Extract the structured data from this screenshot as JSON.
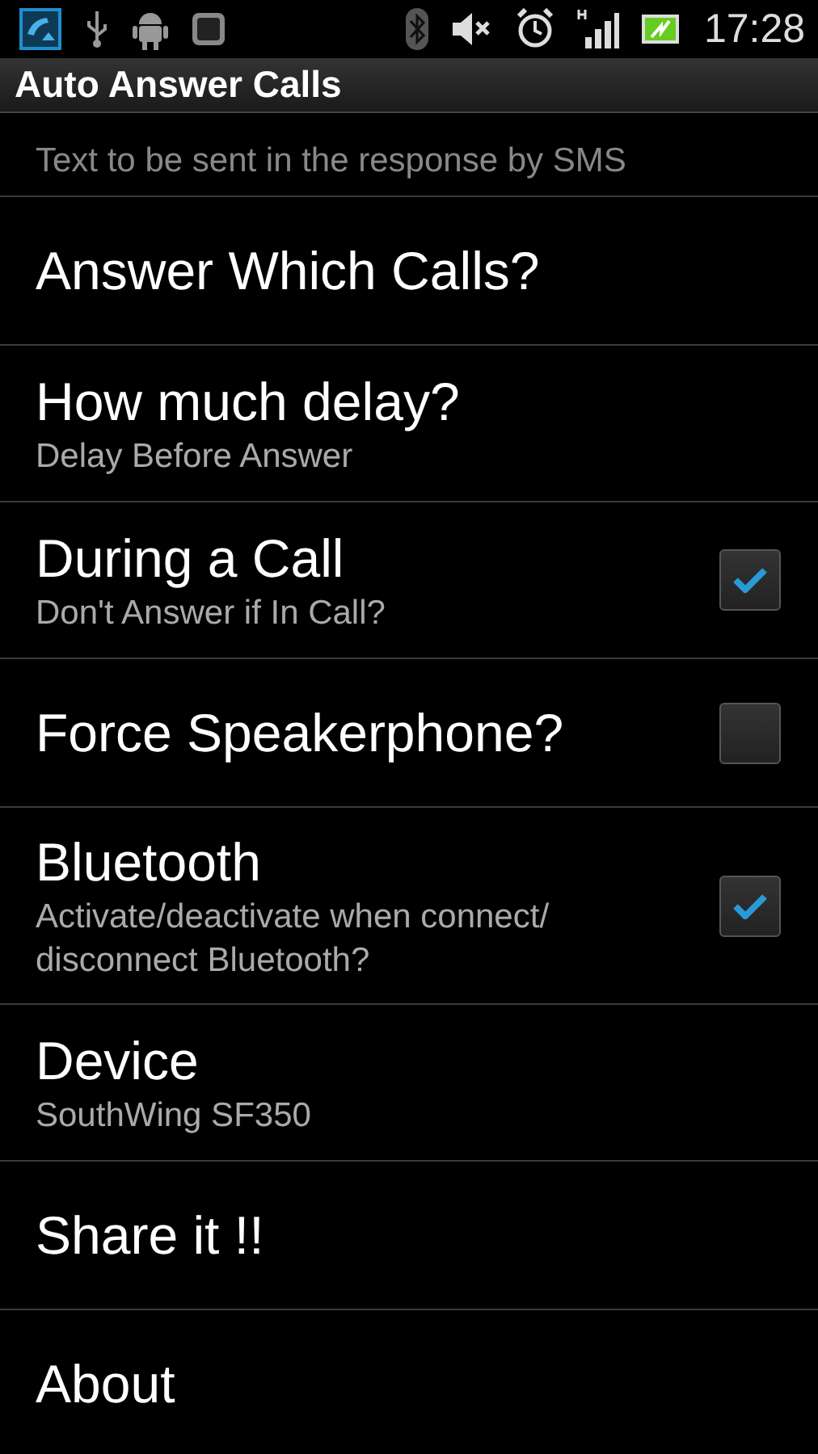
{
  "status_bar": {
    "time": "17:28"
  },
  "window": {
    "title": "Auto Answer Calls"
  },
  "preferences": [
    {
      "kind": "partial",
      "summary": "Text to be sent in the response by SMS"
    },
    {
      "kind": "plain",
      "title": "Answer Which Calls?"
    },
    {
      "kind": "plain",
      "title": "How much delay?",
      "summary": "Delay Before Answer"
    },
    {
      "kind": "checkbox",
      "title": "During a Call",
      "summary": "Don't Answer if In Call?",
      "checked": true
    },
    {
      "kind": "checkbox",
      "title": "Force Speakerphone?",
      "checked": false
    },
    {
      "kind": "checkbox",
      "title": "Bluetooth",
      "summary": "Activate/deactivate when connect/ disconnect Bluetooth?",
      "checked": true
    },
    {
      "kind": "plain",
      "title": "Device",
      "summary": "SouthWing SF350"
    },
    {
      "kind": "plain",
      "title": "Share it !!"
    },
    {
      "kind": "plain",
      "title": "About"
    }
  ]
}
